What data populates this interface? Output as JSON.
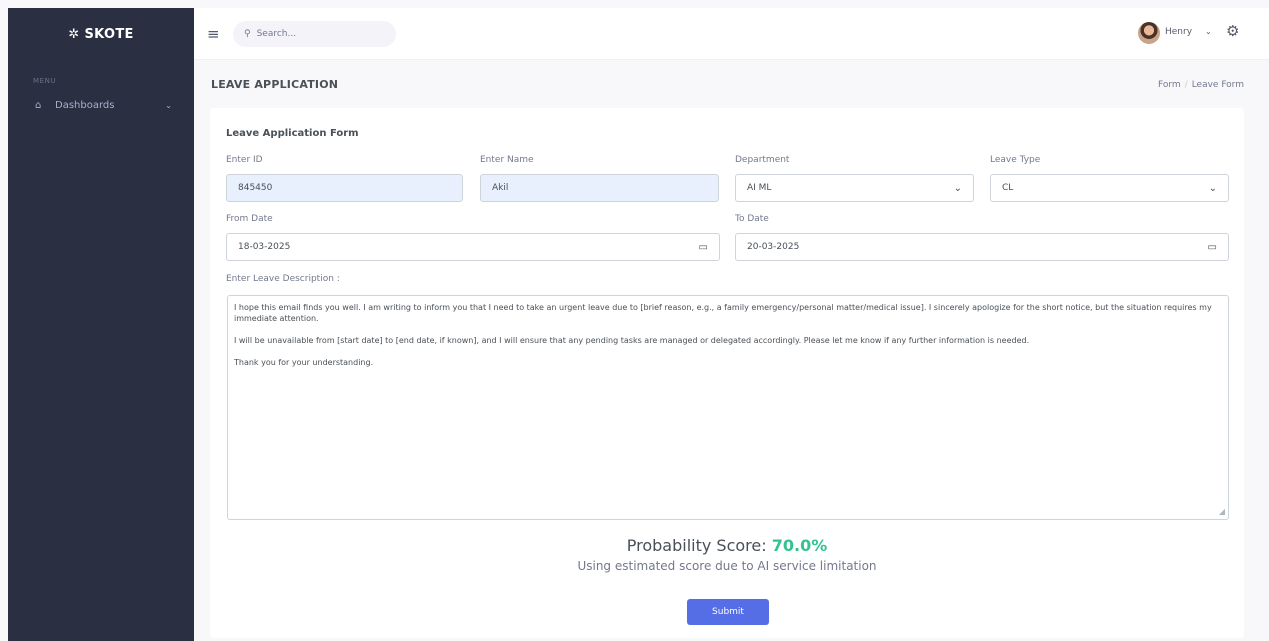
{
  "sidebar": {
    "brand": "SKOTE",
    "menu_title": "MENU",
    "items": [
      {
        "label": "Dashboards",
        "icon": "home-icon"
      }
    ]
  },
  "topbar": {
    "search_placeholder": "Search...",
    "user_name": "Henry"
  },
  "page": {
    "title": "LEAVE APPLICATION",
    "breadcrumb": [
      "Form",
      "Leave Form"
    ]
  },
  "form": {
    "title": "Leave Application Form",
    "id_label": "Enter ID",
    "id_value": "845450",
    "name_label": "Enter Name",
    "name_value": "Akil",
    "department_label": "Department",
    "department_value": "AI ML",
    "leave_type_label": "Leave Type",
    "leave_type_value": "CL",
    "from_date_label": "From Date",
    "from_date_value": "18-03-2025",
    "to_date_label": "To Date",
    "to_date_value": "20-03-2025",
    "description_label": "Enter Leave Description :",
    "description_lines": [
      "I hope this email finds you well. I am writing to inform you that I need to take an urgent leave due to [brief reason, e.g., a family emergency/personal matter/medical issue]. I sincerely apologize for the short notice, but the situation requires my immediate attention.",
      "I will be unavailable from [start date] to [end date, if known], and I will ensure that any pending tasks are managed or delegated accordingly. Please let me know if any further information is needed.",
      "Thank you for your understanding."
    ],
    "submit_label": "Submit"
  },
  "result": {
    "probability_label": "Probability Score:",
    "probability_value": "70.0%",
    "note": "Using estimated score due to AI service limitation"
  },
  "colors": {
    "sidebar_bg": "#2a3042",
    "primary": "#556ee6",
    "success": "#34c38f"
  }
}
